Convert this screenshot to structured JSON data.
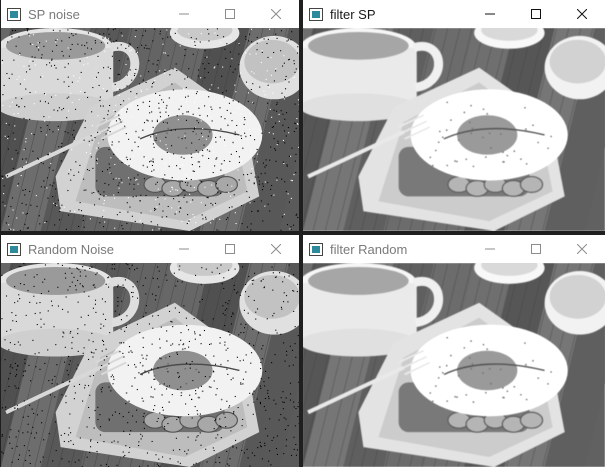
{
  "windows": [
    {
      "title": "SP noise",
      "active": false,
      "noise": "sp",
      "filtered": false
    },
    {
      "title": "filter SP",
      "active": true,
      "noise": "none",
      "filtered": true
    },
    {
      "title": "Random Noise",
      "active": false,
      "noise": "random",
      "filtered": false
    },
    {
      "title": "filter Random",
      "active": false,
      "noise": "none",
      "filtered": true
    }
  ],
  "controls": {
    "minimize_icon": "minimize-icon",
    "maximize_icon": "maximize-icon",
    "close_icon": "close-icon"
  },
  "image_subject": "grayscale photo of fried egg on toast with fork, cup and oranges"
}
